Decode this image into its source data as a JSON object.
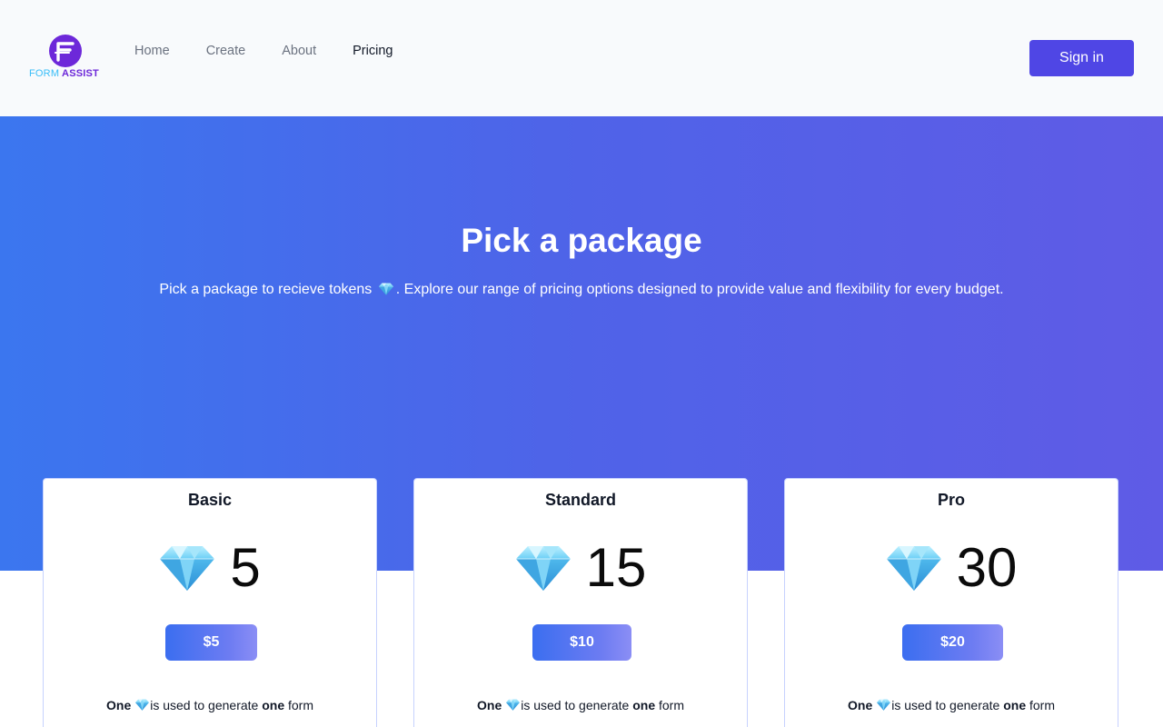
{
  "brand": {
    "logo_form": "FORM",
    "logo_assist": "ASSIST"
  },
  "nav": {
    "items": [
      {
        "label": "Home",
        "active": false
      },
      {
        "label": "Create",
        "active": false
      },
      {
        "label": "About",
        "active": false
      },
      {
        "label": "Pricing",
        "active": true
      }
    ],
    "signin_label": "Sign in"
  },
  "hero": {
    "title": "Pick a package",
    "subtitle_before": "Pick a package to recieve tokens",
    "subtitle_after": ". Explore our range of pricing options designed to provide value and flexibility for every budget.",
    "gem_icon": "gem-icon"
  },
  "packages": [
    {
      "name": "Basic",
      "tokens": "5",
      "price": "$5",
      "note_one": "One",
      "note_mid": "is used to generate",
      "note_one2": "one",
      "note_end": "form"
    },
    {
      "name": "Standard",
      "tokens": "15",
      "price": "$10",
      "note_one": "One",
      "note_mid": "is used to generate",
      "note_one2": "one",
      "note_end": "form"
    },
    {
      "name": "Pro",
      "tokens": "30",
      "price": "$20",
      "note_one": "One",
      "note_mid": "is used to generate",
      "note_one2": "one",
      "note_end": "form"
    }
  ],
  "colors": {
    "accent": "#4f46e5",
    "hero_start": "#3b76ef",
    "hero_end": "#5f5be6",
    "brand_purple": "#6d28d9",
    "brand_blue": "#38bdf8"
  }
}
